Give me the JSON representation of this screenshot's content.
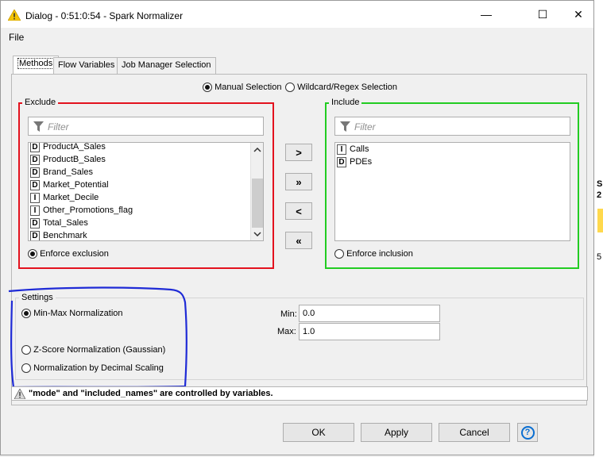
{
  "window": {
    "title": "Dialog - 0:51:0:54 - Spark Normalizer",
    "minimize_glyph": "—",
    "maximize_glyph": "☐",
    "close_glyph": "✕"
  },
  "menu": {
    "file": "File"
  },
  "tabs": [
    {
      "label": "Methods",
      "active": true
    },
    {
      "label": "Flow Variables",
      "active": false
    },
    {
      "label": "Job Manager Selection",
      "active": false
    }
  ],
  "selection_mode": {
    "manual": "Manual Selection",
    "wildcard": "Wildcard/Regex Selection",
    "selected": "manual"
  },
  "exclude": {
    "title": "Exclude",
    "filter_placeholder": "Filter",
    "items": [
      {
        "type": "D",
        "name": "ProductA_Sales"
      },
      {
        "type": "D",
        "name": "ProductB_Sales"
      },
      {
        "type": "D",
        "name": "Brand_Sales"
      },
      {
        "type": "D",
        "name": "Market_Potential"
      },
      {
        "type": "I",
        "name": "Market_Decile"
      },
      {
        "type": "I",
        "name": "Other_Promotions_flag"
      },
      {
        "type": "D",
        "name": "Total_Sales"
      },
      {
        "type": "D",
        "name": "Benchmark"
      }
    ],
    "enforce_label": "Enforce exclusion",
    "enforce_selected": true
  },
  "include": {
    "title": "Include",
    "filter_placeholder": "Filter",
    "items": [
      {
        "type": "I",
        "name": "Calls"
      },
      {
        "type": "D",
        "name": "PDEs"
      }
    ],
    "enforce_label": "Enforce inclusion",
    "enforce_selected": false
  },
  "move_buttons": {
    "add": ">",
    "add_all": "»",
    "remove": "<",
    "remove_all": "«"
  },
  "settings": {
    "title": "Settings",
    "options": [
      {
        "label": "Min-Max Normalization",
        "selected": true
      },
      {
        "label": "Z-Score Normalization (Gaussian)",
        "selected": false
      },
      {
        "label": "Normalization by Decimal Scaling",
        "selected": false
      }
    ],
    "min_label": "Min:",
    "min_value": "0.0",
    "max_label": "Max:",
    "max_value": "1.0"
  },
  "warning": "\"mode\" and \"included_names\" are controlled by variables.",
  "buttons": {
    "ok": "OK",
    "apply": "Apply",
    "cancel": "Cancel",
    "help": "?"
  },
  "colors": {
    "exclude_border": "#e3121e",
    "include_border": "#22cc22",
    "annotation": "#1f2bd6",
    "accent": "#0a6ed1"
  },
  "background_fragment": {
    "line1": "S",
    "line2": "2",
    "line3": "5"
  }
}
